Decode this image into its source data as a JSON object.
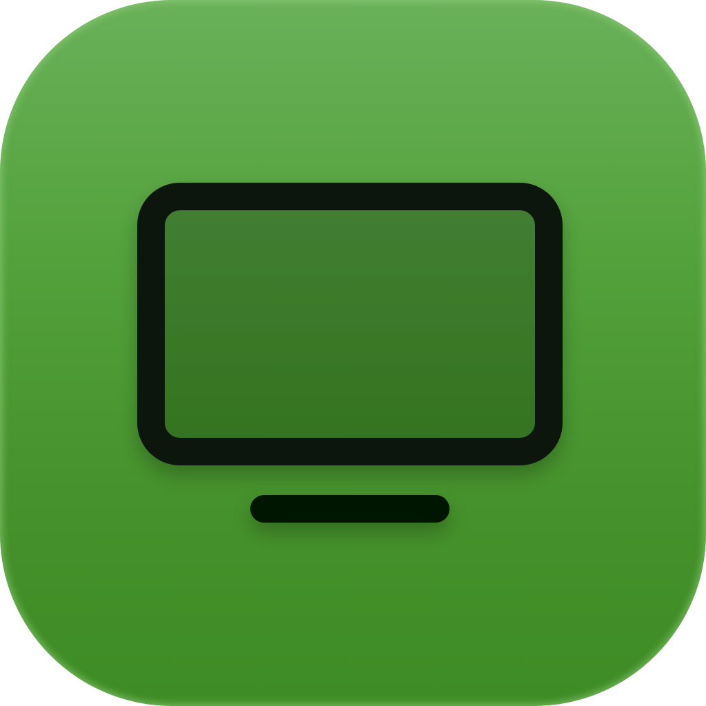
{
  "icon": {
    "name": "monitor-icon",
    "background_top_color": "#6ab159",
    "background_bottom_color": "#3e8c25",
    "screen_fill_color": "#3f7d2f",
    "stroke_color": "#0b160a"
  }
}
